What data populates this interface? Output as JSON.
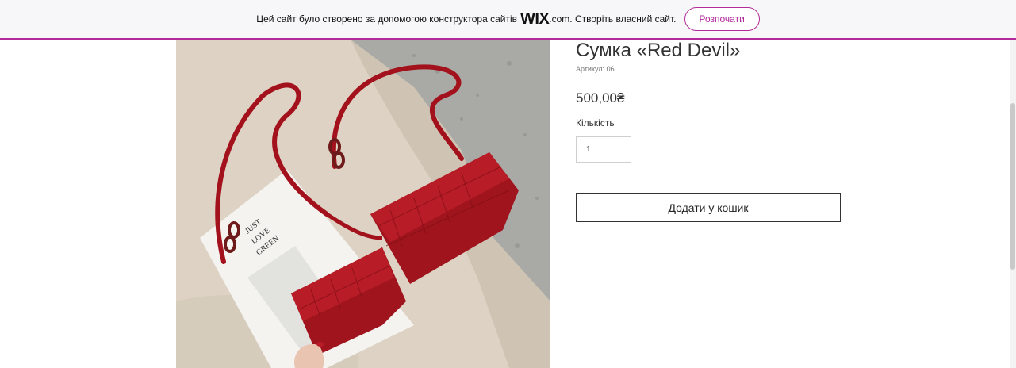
{
  "banner": {
    "text_before": "Цей сайт було створено за допомогою конструктора сайтів",
    "logo": "WIX",
    "text_after": ".com. Створіть власний сайт.",
    "cta_label": "Розпочати",
    "accent_color": "#b32a9b"
  },
  "product": {
    "title": "Сумка «Red Devil»",
    "sku_label": "Артикул:",
    "sku_value": "06",
    "price": "500,00₴",
    "quantity_label": "Кількість",
    "quantity_value": "1",
    "add_to_cart_label": "Додати у кошик",
    "image_booklet_text": [
      "JUST",
      "LOVE",
      "GREEN"
    ]
  }
}
